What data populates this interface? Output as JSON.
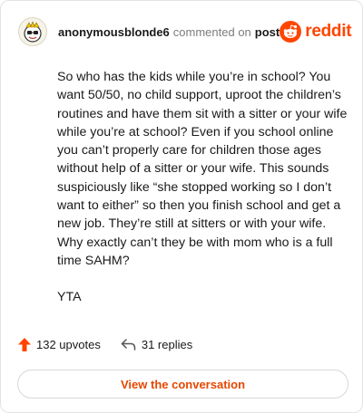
{
  "header": {
    "username": "anonymousblonde6",
    "action": "commented on",
    "link": "post",
    "brand": "reddit"
  },
  "comment": {
    "paragraphs": [
      "So who has the kids while you’re in school? You want 50/50, no child support, uproot the children’s routines and have them sit with a sitter or your wife while you’re at school? Even if you school online you can’t properly care for children those ages without help of a sitter or your wife. This sounds suspiciously like “she stopped working so I don’t want to either” so then you finish school and get a new job. They’re still at sitters or with your wife. Why exactly can’t they be with mom who is a full time SAHM?",
      "YTA"
    ]
  },
  "stats": {
    "upvotes": "132 upvotes",
    "replies": "31 replies"
  },
  "cta": {
    "label": "View the conversation"
  },
  "colors": {
    "brand": "#ff4500",
    "cta_text": "#e54700",
    "muted": "#7c7c7c"
  },
  "icons": {
    "avatar": "avatar-icon",
    "logo": "reddit-alien-icon",
    "upvote": "upvote-arrow-icon",
    "reply": "reply-arrow-icon"
  }
}
